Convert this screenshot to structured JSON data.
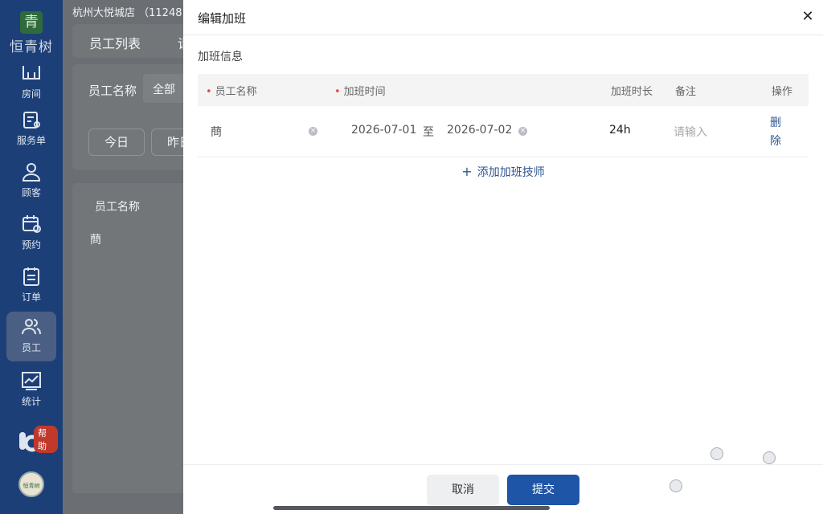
{
  "brand": {
    "mark": "青",
    "name": "恒青树"
  },
  "sidebar": {
    "items": [
      {
        "label": "房间",
        "icon": "room-icon"
      },
      {
        "label": "服务单",
        "icon": "service-order-icon"
      },
      {
        "label": "顾客",
        "icon": "customer-icon"
      },
      {
        "label": "预约",
        "icon": "calendar-icon"
      },
      {
        "label": "订单",
        "icon": "clipboard-icon"
      },
      {
        "label": "员工",
        "icon": "staff-icon",
        "active": true
      },
      {
        "label": "统计",
        "icon": "chart-icon"
      }
    ],
    "help_badge": "帮助",
    "avatar_text": "恒青树"
  },
  "background": {
    "store_name": "杭州大悦城店 （11248",
    "tab_employee_list": "员工列表",
    "tab_partial": "请",
    "filter_label": "员工名称",
    "filter_value": "全部",
    "btn_today": "今日",
    "btn_yesterday": "昨日",
    "table_header": "员工名称",
    "table_cell": "蔄"
  },
  "drawer": {
    "title": "编辑加班",
    "section": "加班信息",
    "columns": {
      "name": "员工名称",
      "time": "加班时间",
      "duration": "加班时长",
      "remark": "备注",
      "action": "操作"
    },
    "row": {
      "name": "蔄",
      "start": "2026-07-01",
      "sep": "至",
      "end": "2026-07-02",
      "duration": "24h",
      "remark_placeholder": "请输入",
      "delete_label": "删除"
    },
    "add_label": "添加加班技师",
    "cancel_label": "取消",
    "submit_label": "提交"
  },
  "colors": {
    "sidebar": "#1c3f78",
    "primary": "#1f55a6",
    "required": "#e34d4d",
    "link": "#2f5590"
  }
}
